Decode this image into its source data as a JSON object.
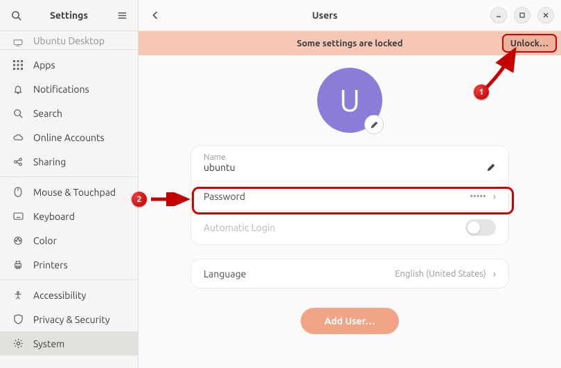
{
  "sidebar": {
    "title": "Settings",
    "cut_item": {
      "label": "Ubuntu Desktop"
    },
    "groups": [
      [
        {
          "label": "Apps"
        },
        {
          "label": "Notifications"
        },
        {
          "label": "Search"
        },
        {
          "label": "Online Accounts"
        },
        {
          "label": "Sharing"
        }
      ],
      [
        {
          "label": "Mouse & Touchpad"
        },
        {
          "label": "Keyboard"
        },
        {
          "label": "Color"
        },
        {
          "label": "Printers"
        }
      ],
      [
        {
          "label": "Accessibility"
        },
        {
          "label": "Privacy & Security"
        },
        {
          "label": "System"
        }
      ]
    ]
  },
  "header": {
    "title": "Users"
  },
  "banner": {
    "text": "Some settings are locked",
    "unlock": "Unlock…"
  },
  "avatar": {
    "initial": "U"
  },
  "name_row": {
    "small": "Name",
    "value": "ubuntu"
  },
  "password_row": {
    "label": "Password",
    "value": "•••••"
  },
  "auto_login": {
    "label": "Automatic Login"
  },
  "language_row": {
    "label": "Language",
    "value": "English (United States)"
  },
  "add_user": "Add User…",
  "annotations": {
    "b1": "1",
    "b2": "2"
  }
}
